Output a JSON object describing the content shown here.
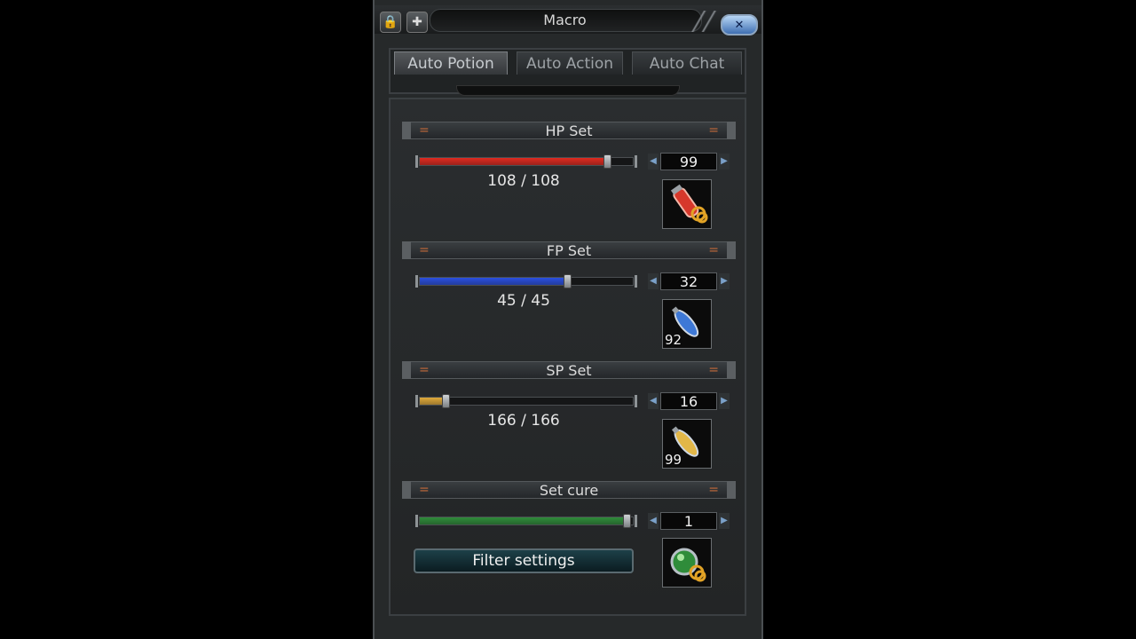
{
  "window": {
    "title": "Macro",
    "icons": [
      "lock-icon",
      "plus-icon",
      "close-icon"
    ]
  },
  "tabs": [
    {
      "label": "Auto Potion",
      "active": true
    },
    {
      "label": "Auto Action",
      "active": false
    },
    {
      "label": "Auto Chat",
      "active": false
    }
  ],
  "sections": [
    {
      "title": "HP Set",
      "value_text": "108 / 108",
      "spin_value": "99",
      "slot_count": "",
      "slider_level": 0.88,
      "color": "#e02a1f"
    },
    {
      "title": "FP Set",
      "value_text": "45 / 45",
      "spin_value": "32",
      "slot_count": "92",
      "slider_level": 0.69,
      "color": "#2a4fe0"
    },
    {
      "title": "SP Set",
      "value_text": "166 / 166",
      "spin_value": "16",
      "slot_count": "99",
      "slider_level": 0.12,
      "color": "#e0a93a"
    },
    {
      "title": "Set cure",
      "value_text": "",
      "spin_value": "1",
      "slot_count": "",
      "slider_level": 0.97,
      "color": "#2f8c3a"
    }
  ],
  "filter_button": {
    "label": "Filter settings"
  }
}
